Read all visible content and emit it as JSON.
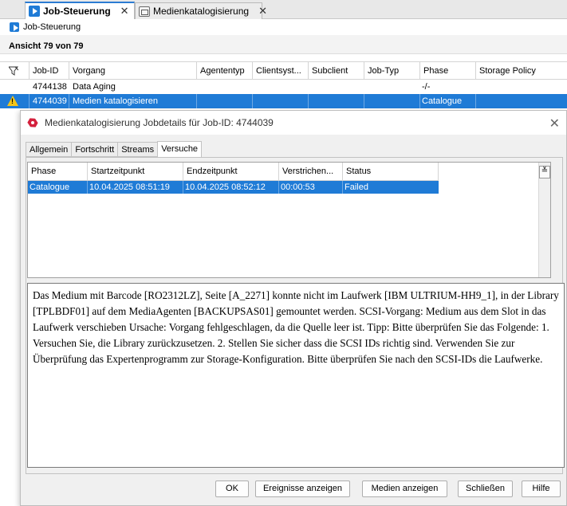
{
  "tabs": [
    {
      "label": "Job-Steuerung",
      "active": true
    },
    {
      "label": "Medienkatalogisierung",
      "active": false
    }
  ],
  "breadcrumb": "Job-Steuerung",
  "view_count": "Ansicht 79 von 79",
  "grid": {
    "columns": [
      "Job-ID",
      "Vorgang",
      "Agententyp",
      "Clientsyst...",
      "Subclient",
      "Job-Typ",
      "Phase",
      "Storage Policy"
    ],
    "rows": [
      {
        "job_id": "4744138",
        "vorgang": "Data Aging",
        "agententyp": "",
        "clientsystem": "",
        "subclient": "",
        "job_typ": "",
        "phase": "-/-",
        "storage_policy": "",
        "warning": false,
        "selected": false
      },
      {
        "job_id": "4744039",
        "vorgang": "Medien katalogisieren",
        "agententyp": "",
        "clientsystem": "",
        "subclient": "",
        "job_typ": "",
        "phase": "Catalogue",
        "storage_policy": "",
        "warning": true,
        "selected": true
      }
    ]
  },
  "dialog": {
    "title": "Medienkatalogisierung Jobdetails für Job-ID: 4744039",
    "tabs": [
      "Allgemein",
      "Fortschritt",
      "Streams",
      "Versuche"
    ],
    "active_tab": "Versuche",
    "attempts": {
      "columns": [
        "Phase",
        "Startzeitpunkt",
        "Endzeitpunkt",
        "Verstrichen...",
        "Status"
      ],
      "rows": [
        {
          "phase": "Catalogue",
          "start": "10.04.2025 08:51:19",
          "end": "10.04.2025 08:52:12",
          "elapsed": "00:00:53",
          "status": "Failed"
        }
      ]
    },
    "message": "Das Medium mit Barcode [RO2312LZ], Seite [A_2271] konnte nicht im Laufwerk [IBM ULTRIUM-HH9_1], in der Library [TPLBDF01] auf dem MediaAgenten [BACKUPSAS01] gemountet werden. SCSI-Vorgang: Medium aus dem Slot in das Laufwerk verschieben Ursache: Vorgang fehlgeschlagen, da die Quelle leer ist. Tipp: Bitte überprüfen Sie das Folgende: 1. Versuchen Sie, die Library zurückzusetzen. 2. Stellen Sie sicher dass die SCSI IDs richtig sind. Verwenden Sie zur Überprüfung das Expertenprogramm zur Storage-Konfiguration. Bitte überprüfen Sie nach den SCSI-IDs die Laufwerke.",
    "buttons": {
      "ok": "OK",
      "events": "Ereignisse anzeigen",
      "media": "Medien anzeigen",
      "close": "Schließen",
      "help": "Hilfe"
    }
  },
  "colors": {
    "selection": "#1f7bd6",
    "accent": "#2b7cd3"
  }
}
